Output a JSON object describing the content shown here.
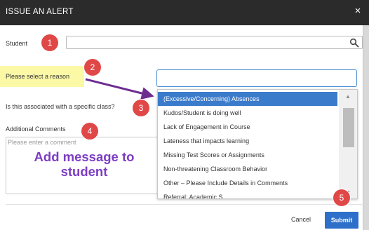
{
  "dialog": {
    "title": "ISSUE AN ALERT",
    "close_label": "×"
  },
  "form": {
    "student_label": "Student",
    "student_value": "",
    "reason_label": "Please select a reason",
    "reason_value": "",
    "class_label": "Is this associated with a specific class?",
    "comments_label": "Additional Comments",
    "comments_placeholder": "Please enter a comment"
  },
  "dropdown": {
    "options": [
      "(Excessive/Concerning) Absences",
      "Kudos/Student is doing well",
      "Lack of Engagement in Course",
      "Lateness that impacts learning",
      "Missing Test Scores or Assignments",
      "Non-threatening Classroom Behavior",
      "Other – Please Include Details in Comments",
      "Referral: Academic S..."
    ],
    "selected_index": 0
  },
  "annotations": {
    "badges": [
      "1",
      "2",
      "3",
      "4",
      "5"
    ],
    "overlay_text": "Add message to student",
    "badge_color": "#e04848",
    "arrow_color": "#6e2d91",
    "overlay_color": "#7d3dc3"
  },
  "actions": {
    "cancel_label": "Cancel",
    "submit_label": "Submit"
  },
  "colors": {
    "header_bg": "#2b2b2b",
    "accent": "#2e6fc9",
    "selected_option_bg": "#3b7bcb",
    "reason_highlight": "#fbf8a6"
  },
  "icons": {
    "search": "search-icon",
    "close": "close-icon",
    "scroll_up": "chevron-up-icon",
    "scroll_down": "chevron-down-icon"
  }
}
